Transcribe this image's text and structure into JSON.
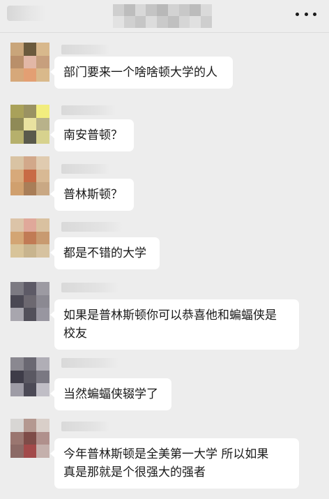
{
  "header": {
    "title_icon": "blurred-group-name",
    "back_icon": "blurred-back-area",
    "more_icon": "ellipsis-horizontal"
  },
  "messages": [
    {
      "text": "部门要来一个啥啥顿大学的人"
    },
    {
      "text": "南安普顿？"
    },
    {
      "text": "普林斯顿？"
    },
    {
      "text": "都是不错的大学"
    },
    {
      "text": "如果是普林斯顿你可以恭喜他和蝙蝠侠是\n校友"
    },
    {
      "text": "当然蝙蝠侠辍学了"
    },
    {
      "text": "今年普林斯顿是全美第一大学 所以如果\n真是那就是个很强大的强者"
    }
  ],
  "colors": {
    "background": "#ededed",
    "bubble": "#ffffff",
    "text": "#191919"
  }
}
